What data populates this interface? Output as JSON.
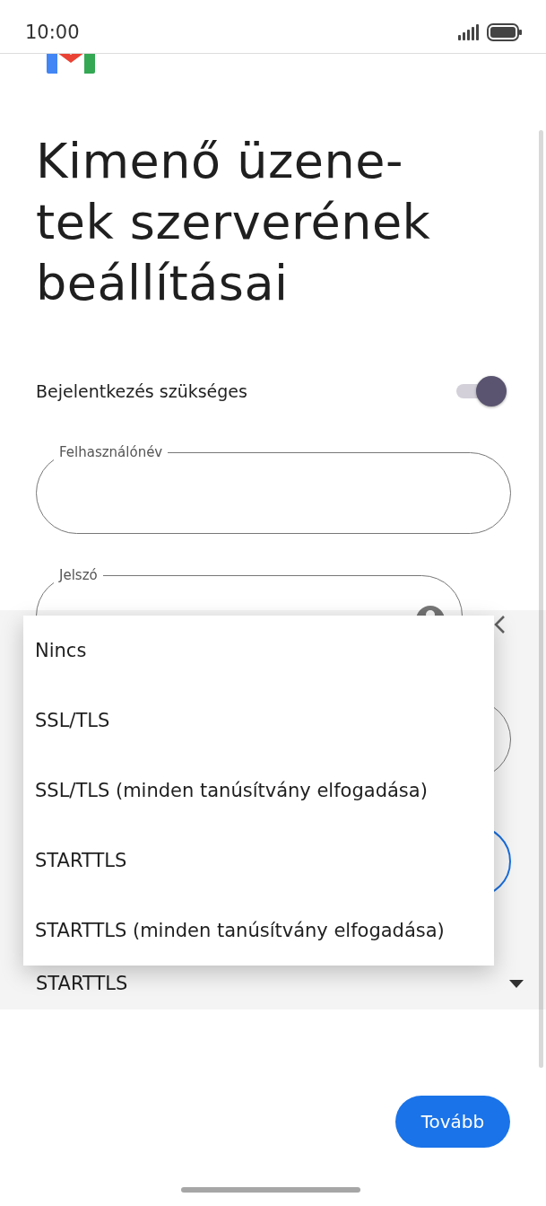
{
  "status_bar": {
    "time": "10:00"
  },
  "title": "Kimenő üzene-\ntek szerverének\nbeállításai",
  "login_required": {
    "label": "Bejelentkezés szükséges",
    "on": true
  },
  "username": {
    "label": "Felhasználónév"
  },
  "password": {
    "label": "Jelszó"
  },
  "security": {
    "value": "STARTTLS"
  },
  "menu": [
    {
      "label": "Nincs",
      "selected": false
    },
    {
      "label": "SSL/TLS",
      "selected": false
    },
    {
      "label": "SSL/TLS (minden tanúsítvány elfogadása)",
      "selected": false
    },
    {
      "label": "STARTTLS",
      "selected": false
    },
    {
      "label": "STARTTLS (minden tanúsítvány elfogadása)",
      "selected": false
    }
  ],
  "next_button": "Tovább"
}
